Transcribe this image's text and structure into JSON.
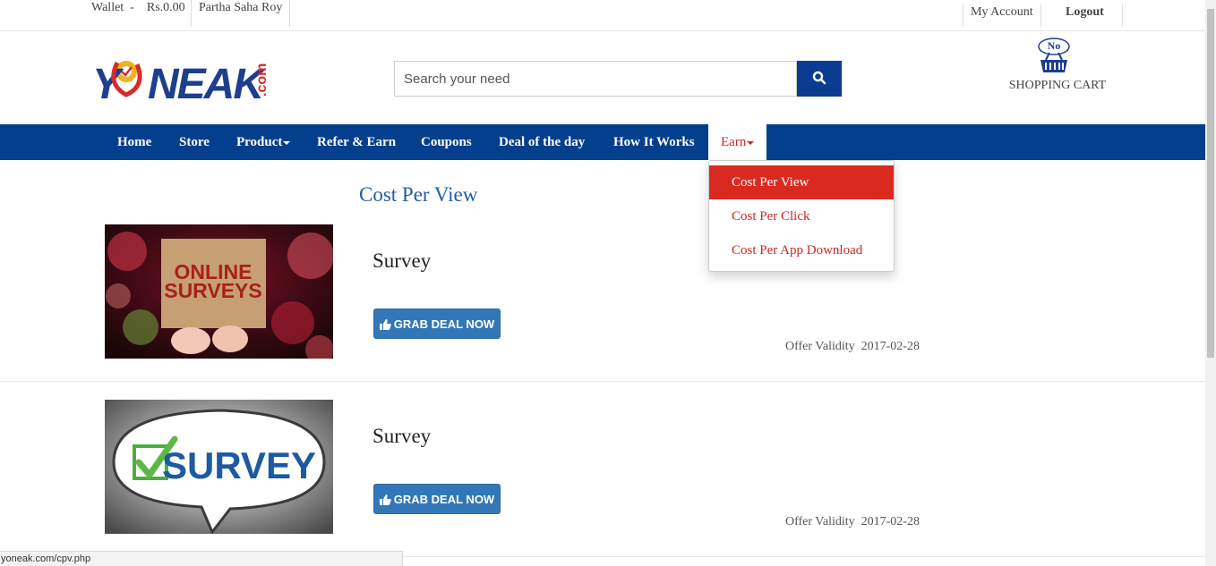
{
  "topbar": {
    "wallet_label": "Wallet  -    Rs.0.00",
    "user_name": "Partha Saha Roy",
    "my_account": "My Account",
    "logout": "Logout"
  },
  "header": {
    "logo_text": "YONEAK",
    "logo_suffix": ".com",
    "search_placeholder": "Search your need",
    "cart_badge": "No",
    "cart_label": "SHOPPING CART"
  },
  "nav": {
    "items": [
      "Home",
      "Store",
      "Product",
      "Refer & Earn",
      "Coupons",
      "Deal of the day",
      "How It Works",
      "Earn"
    ]
  },
  "earn_menu": {
    "items": [
      "Cost Per View",
      "Cost Per Click",
      "Cost Per App Download"
    ],
    "active": "Cost Per View"
  },
  "main": {
    "title": "Cost Per View",
    "deals": [
      {
        "title": "Survey",
        "button": "GRAB DEAL NOW",
        "validity_label": "Offer Validity",
        "validity_date": "2017-02-28",
        "image_text_1": "ONLINE",
        "image_text_2": "SURVEYS"
      },
      {
        "title": "Survey",
        "button": "GRAB DEAL NOW",
        "validity_label": "Offer Validity",
        "validity_date": "2017-02-28",
        "image_text_1": "SURVEY"
      }
    ]
  },
  "status_bar": {
    "url": "yoneak.com/cpv.php"
  },
  "colors": {
    "brand_blue": "#043f8d",
    "accent_red": "#da2a20",
    "button_blue": "#3278b8",
    "title_blue": "#1f5ca8"
  }
}
